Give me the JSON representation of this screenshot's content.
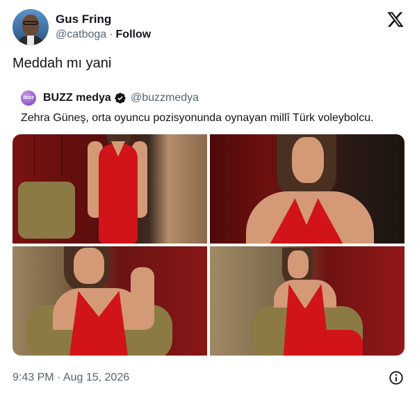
{
  "author": {
    "name": "Gus Fring",
    "handle": "@catboga",
    "separator": "·",
    "follow_label": "Follow",
    "avatar_icon": "user-avatar"
  },
  "brand_icon": "x-logo-icon",
  "tweet": {
    "text": "Meddah mı yani"
  },
  "quoted_tweet": {
    "avatar_text": "buzz",
    "name": "BUZZ medya",
    "verified_icon": "verified-badge-icon",
    "handle": "@buzzmedya",
    "text": "Zehra Güneş, orta oyuncu pozisyonunda oynayan millî Türk voleybolcu.",
    "media_count": 4
  },
  "footer": {
    "timestamp": "9:43 PM · Aug 15, 2026",
    "info_icon": "info-icon"
  },
  "colors": {
    "text_primary": "#0f1419",
    "text_secondary": "#536471",
    "dress_red": "#d0141a",
    "buzz_purple": "#9b5fd1"
  }
}
